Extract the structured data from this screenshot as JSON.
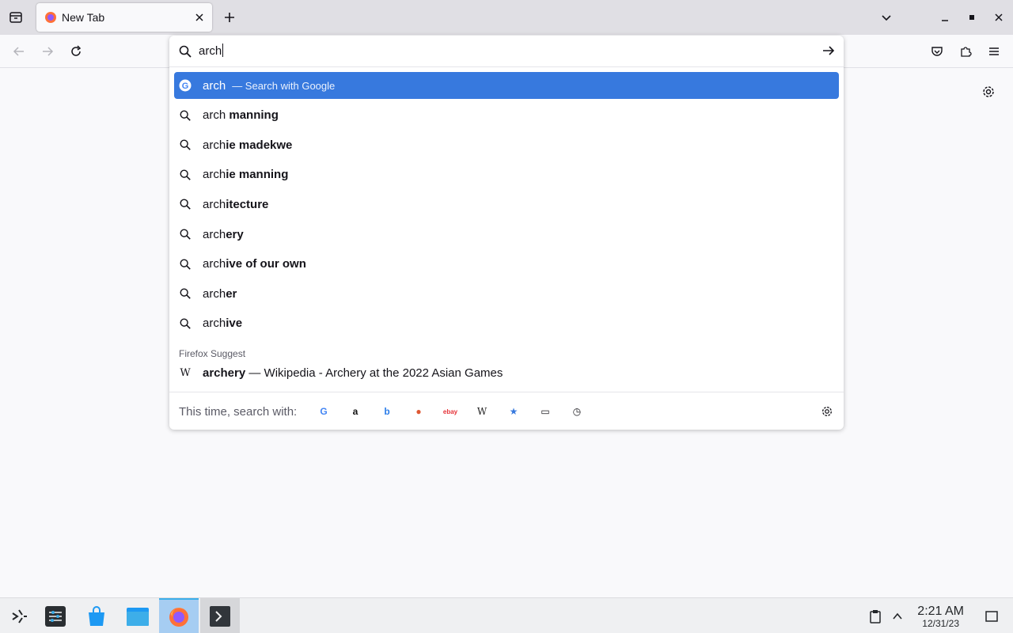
{
  "tab": {
    "title": "New Tab"
  },
  "urlbar": {
    "typed": "arch",
    "results": [
      {
        "prefix": "arch",
        "suffix": "",
        "action": "— Search with Google",
        "icon": "google-icon",
        "selected": true
      },
      {
        "prefix": "arch",
        "suffix": " manning",
        "icon": "search-icon"
      },
      {
        "prefix": "arch",
        "suffix": "ie madekwe",
        "icon": "search-icon"
      },
      {
        "prefix": "arch",
        "suffix": "ie manning",
        "icon": "search-icon"
      },
      {
        "prefix": "arch",
        "suffix": "itecture",
        "icon": "search-icon"
      },
      {
        "prefix": "arch",
        "suffix": "ery",
        "icon": "search-icon"
      },
      {
        "prefix": "arch",
        "suffix": "ive of our own",
        "icon": "search-icon"
      },
      {
        "prefix": "arch",
        "suffix": "er",
        "icon": "search-icon"
      },
      {
        "prefix": "arch",
        "suffix": "ive",
        "icon": "search-icon"
      }
    ],
    "suggest_group_label": "Firefox Suggest",
    "suggest": {
      "bold": "archery",
      "rest": " — Wikipedia - Archery at the 2022 Asian Games",
      "icon": "wikipedia-icon"
    },
    "oneoff_label": "This time, search with:",
    "engines": [
      {
        "name": "google-icon",
        "glyph": "G",
        "color": "#4285f4"
      },
      {
        "name": "amazon-icon",
        "glyph": "a",
        "color": "#111111"
      },
      {
        "name": "bing-icon",
        "glyph": "b",
        "color": "#2b7de9"
      },
      {
        "name": "duckduckgo-icon",
        "glyph": "●",
        "color": "#de5833"
      },
      {
        "name": "ebay-icon",
        "glyph": "ebay",
        "color": "#e53238"
      },
      {
        "name": "wikipedia-icon",
        "glyph": "W",
        "color": "#222222"
      },
      {
        "name": "bookmarks-icon",
        "glyph": "★",
        "color": "#3779de"
      },
      {
        "name": "tabs-icon",
        "glyph": "▭",
        "color": "#15141a"
      },
      {
        "name": "history-icon",
        "glyph": "◷",
        "color": "#15141a"
      }
    ]
  },
  "clock": {
    "time": "2:21 AM",
    "date": "12/31/23"
  }
}
